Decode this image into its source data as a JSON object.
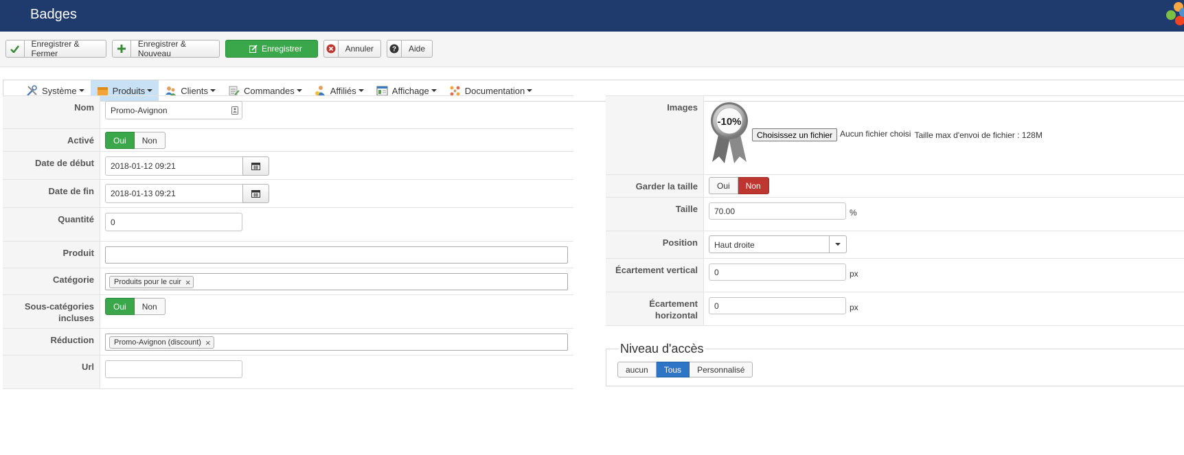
{
  "header": {
    "title": "Badges"
  },
  "toolbar": {
    "save_close": "Enregistrer & Fermer",
    "save_new": "Enregistrer & Nouveau",
    "save": "Enregistrer",
    "cancel": "Annuler",
    "help": "Aide"
  },
  "menu": {
    "items": [
      {
        "label": "Système"
      },
      {
        "label": "Produits"
      },
      {
        "label": "Clients"
      },
      {
        "label": "Commandes"
      },
      {
        "label": "Affiliés"
      },
      {
        "label": "Affichage"
      },
      {
        "label": "Documentation"
      }
    ],
    "active": "Produits"
  },
  "form_left": {
    "nom": {
      "label": "Nom",
      "value": "Promo-Avignon"
    },
    "active": {
      "label": "Activé",
      "yes": "Oui",
      "no": "Non",
      "selected": "Oui"
    },
    "date_debut": {
      "label": "Date de début",
      "value": "2018-01-12 09:21"
    },
    "date_fin": {
      "label": "Date de fin",
      "value": "2018-01-13 09:21"
    },
    "quantite": {
      "label": "Quantité",
      "value": "0"
    },
    "produit": {
      "label": "Produit",
      "value": ""
    },
    "categorie": {
      "label": "Catégorie",
      "tag": "Produits pour le cuir"
    },
    "sous_categories": {
      "label": "Sous-catégories incluses",
      "yes": "Oui",
      "no": "Non",
      "selected": "Oui"
    },
    "reduction": {
      "label": "Réduction",
      "tag": "Promo-Avignon (discount)"
    },
    "url": {
      "label": "Url",
      "value": ""
    }
  },
  "form_right": {
    "images": {
      "label": "Images",
      "badge_text": "-10%",
      "file_button": "Choisissez un fichier",
      "no_file": "Aucun fichier choisi",
      "max_size": "Taille max d'envoi de fichier : 128M"
    },
    "garder_taille": {
      "label": "Garder la taille",
      "yes": "Oui",
      "no": "Non",
      "selected": "Non"
    },
    "taille": {
      "label": "Taille",
      "value": "70.00",
      "unit": "%"
    },
    "position": {
      "label": "Position",
      "value": "Haut droite"
    },
    "ecart_vertical": {
      "label": "Écartement vertical",
      "value": "0",
      "unit": "px"
    },
    "ecart_horizontal": {
      "label": "Écartement horizontal",
      "value": "0",
      "unit": "px"
    }
  },
  "access": {
    "legend": "Niveau d'accès",
    "options": [
      "aucun",
      "Tous",
      "Personnalisé"
    ],
    "selected": "Tous"
  },
  "colors": {
    "header_bg": "#1f3a6d",
    "success": "#3aa84a",
    "danger": "#bd362f",
    "primary": "#2f75c6",
    "menu_active": "#c9e1f5"
  }
}
